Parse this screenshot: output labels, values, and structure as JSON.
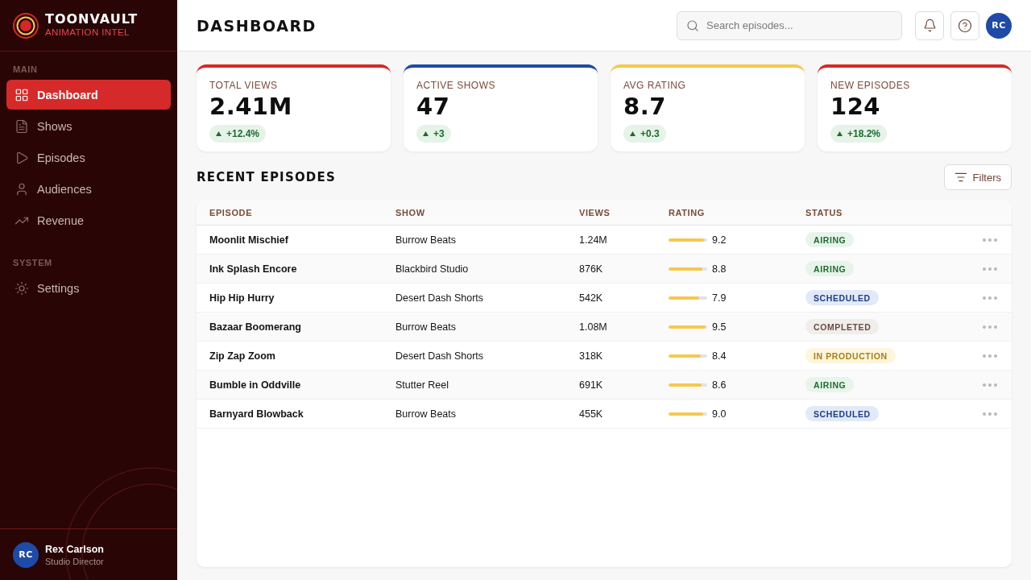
{
  "sidebar": {
    "brand": {
      "name": "TOONVAULT",
      "tagline": "ANIMATION INTEL"
    },
    "sections": [
      {
        "label": "MAIN",
        "items": [
          {
            "label": "Dashboard",
            "kind": "grid",
            "selected": true
          },
          {
            "label": "Shows",
            "kind": "document",
            "selected": false
          },
          {
            "label": "Episodes",
            "kind": "play",
            "selected": false
          },
          {
            "label": "Audiences",
            "kind": "person",
            "selected": false
          },
          {
            "label": "Revenue",
            "kind": "trend",
            "selected": false
          }
        ]
      },
      {
        "label": "SYSTEM",
        "items": [
          {
            "label": "Settings",
            "kind": "settings",
            "selected": false
          }
        ]
      }
    ],
    "user": {
      "initials": "RC",
      "name": "Rex Carlson",
      "role": "Studio Director"
    }
  },
  "header": {
    "title": "DASHBOARD",
    "search": {
      "placeholder": "Search episodes..."
    },
    "avatar": "RC"
  },
  "stats": [
    {
      "label": "TOTAL VIEWS",
      "value": "2.41M",
      "delta": "+12.4%",
      "color": "#d62828"
    },
    {
      "label": "ACTIVE SHOWS",
      "value": "47",
      "delta": "+3",
      "color": "#1e4aa8"
    },
    {
      "label": "AVG RATING",
      "value": "8.7",
      "delta": "+0.3",
      "color": "#f4c94f"
    },
    {
      "label": "NEW EPISODES",
      "value": "124",
      "delta": "+18.2%",
      "color": "#d62828"
    }
  ],
  "recent_episodes": {
    "title": "RECENT EPISODES",
    "filters_button": "Filters",
    "columns": [
      "EPISODE",
      "SHOW",
      "VIEWS",
      "RATING",
      "STATUS"
    ],
    "rows": [
      {
        "episode": "Moonlit Mischief",
        "show": "Burrow Beats",
        "views": "1.24M",
        "rating": "9.2",
        "level": 0.92,
        "status": {
          "kind": "airing",
          "label": "AIRING"
        }
      },
      {
        "episode": "Ink Splash Encore",
        "show": "Blackbird Studio",
        "views": "876K",
        "rating": "8.8",
        "level": 0.88,
        "status": {
          "kind": "airing",
          "label": "AIRING"
        }
      },
      {
        "episode": "Hip Hip Hurry",
        "show": "Desert Dash Shorts",
        "views": "542K",
        "rating": "7.9",
        "level": 0.79,
        "status": {
          "kind": "scheduled",
          "label": "SCHEDULED"
        }
      },
      {
        "episode": "Bazaar Boomerang",
        "show": "Burrow Beats",
        "views": "1.08M",
        "rating": "9.5",
        "level": 0.95,
        "status": {
          "kind": "completed",
          "label": "COMPLETED"
        }
      },
      {
        "episode": "Zip Zap Zoom",
        "show": "Desert Dash Shorts",
        "views": "318K",
        "rating": "8.4",
        "level": 0.84,
        "status": {
          "kind": "production",
          "label": "IN PRODUCTION"
        }
      },
      {
        "episode": "Bumble in Oddville",
        "show": "Stutter Reel",
        "views": "691K",
        "rating": "8.6",
        "level": 0.86,
        "status": {
          "kind": "airing",
          "label": "AIRING"
        }
      },
      {
        "episode": "Barnyard Blowback",
        "show": "Burrow Beats",
        "views": "455K",
        "rating": "9.0",
        "level": 0.9,
        "status": {
          "kind": "scheduled",
          "label": "SCHEDULED"
        }
      }
    ]
  }
}
